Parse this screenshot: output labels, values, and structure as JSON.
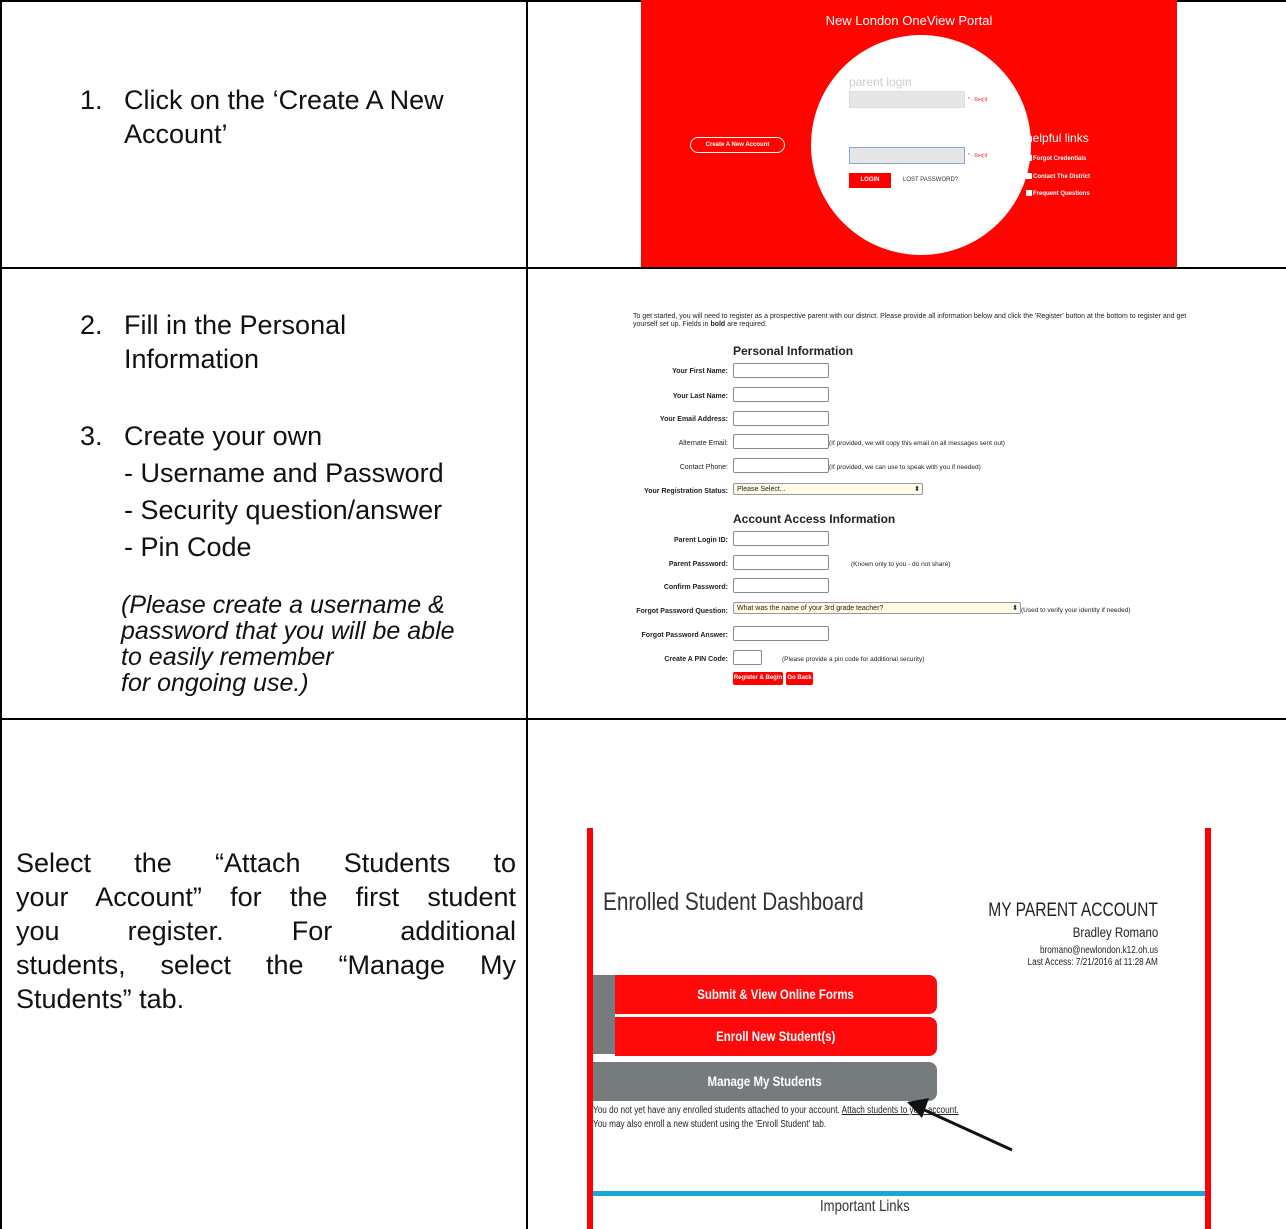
{
  "steps": {
    "step1": {
      "num": "1.",
      "line1": "Click on the ‘Create A New",
      "line2": "Account’"
    },
    "step2": {
      "num": "2.",
      "line1": "Fill in the Personal",
      "line2": "Information"
    },
    "step3": {
      "num": "3.",
      "line1": "Create your own",
      "line2": "- Username and Password",
      "line3": "- Security question/answer",
      "line4": "- Pin Code"
    },
    "note": [
      "(Please create a username &",
      "password that you will be able",
      "to easily remember",
      "for ongoing use.)"
    ],
    "attach": [
      "Select the “Attach Students to",
      "your Account” for the first student",
      "you register. For additional",
      "students, select the “Manage My",
      "Students” tab."
    ]
  },
  "portal": {
    "title": "New London OneView Portal",
    "login_heading": "parent login",
    "req_label": "* - Req'd",
    "login_button": "LOGIN",
    "lost_password": "LOST PASSWORD?",
    "create_account": "Create A New Account",
    "helpful_links_title": "helpful links",
    "helpful_links": [
      "Forgot Credentials",
      "Contact The District",
      "Frequent Questions"
    ],
    "accent": "#ff0500"
  },
  "form": {
    "intro": "To get started, you will need to register as a prospective parent with our district. Please provide all information below and click the 'Register' button at the bottom to register and get yourself set up. Fields in bold are required.",
    "personal_heading": "Personal Information",
    "first_name": "Your First Name:",
    "last_name": "Your Last Name:",
    "email": "Your Email Address:",
    "alt_email": "Alternate Email:",
    "alt_email_note": "(If provided, we will copy this email on all messages sent out)",
    "phone": "Contact Phone:",
    "phone_note": "(If provided, we can use to speak with you if needed)",
    "reg_status": "Your Registration Status:",
    "reg_status_value": "Please Select...",
    "access_heading": "Account Access Information",
    "login_id": "Parent Login ID:",
    "password": "Parent Password:",
    "password_note": "(Known only to you - do not share)",
    "confirm_password": "Confirm Password:",
    "question": "Forgot Password Question:",
    "question_value": "What was the name of your 3rd grade teacher?",
    "question_note": "(Used to verify your identity if needed)",
    "answer": "Forgot Password Answer:",
    "pin": "Create A PIN Code:",
    "pin_note": "(Please provide a pin code for additional security)",
    "register_button": "Register & Begin",
    "back_button": "Go Back"
  },
  "dashboard": {
    "title": "Enrolled Student Dashboard",
    "account_heading": "MY PARENT ACCOUNT",
    "user_name": "Bradley Romano",
    "user_email": "bromano@newlondon.k12.oh.us",
    "last_access": "Last Access: 7/21/2016 at 11:28 AM",
    "tabs": [
      "Submit & View Online Forms",
      "Enroll New Student(s)",
      "Manage My Students"
    ],
    "msg1_pre": "You do not yet have any enrolled students attached to your account.",
    "msg1_link": "Attach students to your account.",
    "msg2": "You may also enroll a new student using the 'Enroll Student' tab.",
    "important_links": "Important Links"
  }
}
